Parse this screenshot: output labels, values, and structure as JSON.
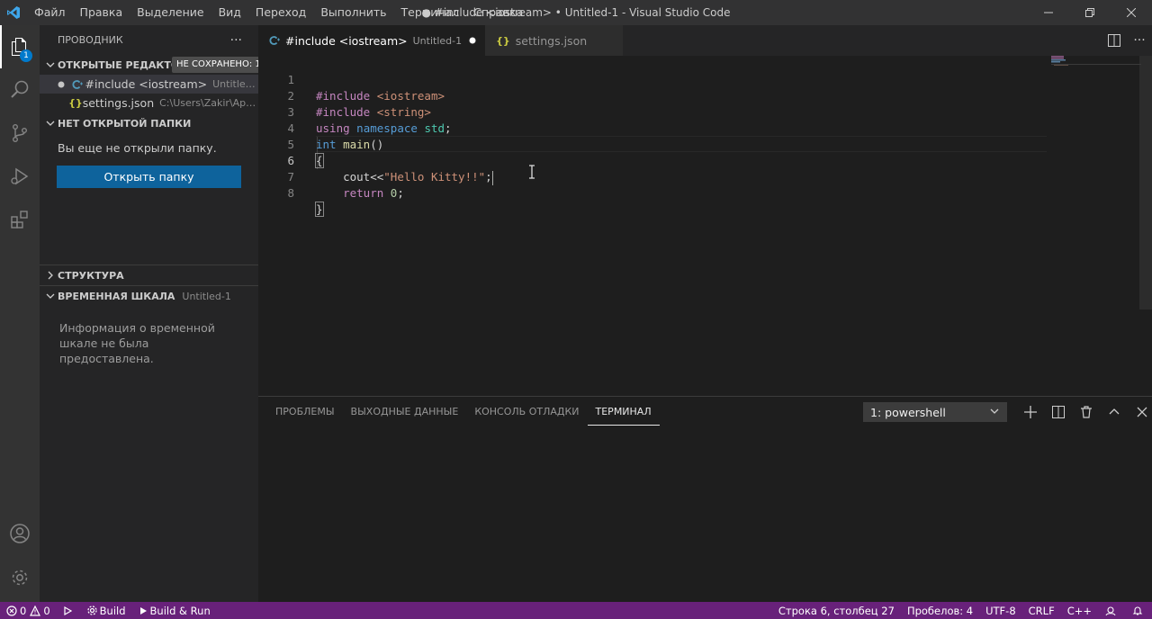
{
  "menu": [
    "Файл",
    "Правка",
    "Выделение",
    "Вид",
    "Переход",
    "Выполнить",
    "Терминал",
    "Справка"
  ],
  "window_title": "● #include <iostream> • Untitled-1 - Visual Studio Code",
  "activity": {
    "explorer_badge": "1"
  },
  "sidebar": {
    "header": "ПРОВОДНИК",
    "more": "···",
    "open_editors": {
      "title": "ОТКРЫТЫЕ РЕДАКТО...",
      "unsaved_badge": "НЕ СОХРАНЕНО: 1",
      "items": [
        {
          "name": "#include <iostream>",
          "desc": "Untitled-1"
        },
        {
          "name": "settings.json",
          "desc": "C:\\Users\\Zakir\\AppDa..."
        }
      ]
    },
    "no_folder": {
      "title": "НЕТ ОТКРЫТОЙ ПАПКИ",
      "text": "Вы еще не открыли папку.",
      "button": "Открыть папку"
    },
    "outline": {
      "title": "СТРУКТУРА"
    },
    "timeline": {
      "title": "ВРЕМЕННАЯ ШКАЛА",
      "subtitle": "Untitled-1",
      "info": "Информация о временной шкале не была предоставлена."
    }
  },
  "tabs": [
    {
      "label": "#include <iostream>",
      "desc": "Untitled-1"
    },
    {
      "label": "settings.json"
    }
  ],
  "code": {
    "line_numbers": [
      "1",
      "2",
      "3",
      "4",
      "5",
      "6",
      "7",
      "8"
    ],
    "l1": {
      "pre": "#include",
      "inc": "<iostream>"
    },
    "l2": {
      "pre": "#include",
      "inc": "<string>"
    },
    "l3": {
      "using": "using",
      "namespace": "namespace",
      "std": "std",
      "semi": ";"
    },
    "l4": {
      "int": "int",
      "main": "main",
      "parens": "()"
    },
    "l5": {
      "brace": "{"
    },
    "l6": {
      "cout": "cout<<",
      "str": "\"Hello Kitty!!\"",
      "semi": ";"
    },
    "l7": {
      "ret": "return",
      "zero": "0",
      "semi": ";"
    },
    "l8": {
      "brace": "}"
    }
  },
  "panel": {
    "tabs": [
      "ПРОБЛЕМЫ",
      "ВЫХОДНЫЕ ДАННЫЕ",
      "КОНСОЛЬ ОТЛАДКИ",
      "ТЕРМИНАЛ"
    ],
    "terminal_select": "1: powershell"
  },
  "status": {
    "errors": "0",
    "warnings": "0",
    "build": "Build",
    "build_run": "Build & Run",
    "position": "Строка 6, столбец 27",
    "spaces": "Пробелов: 4",
    "encoding": "UTF-8",
    "eol": "CRLF",
    "language": "C++"
  },
  "colors": {
    "status_bar": "#68217a",
    "accent": "#007acc",
    "button": "#0e639c"
  }
}
